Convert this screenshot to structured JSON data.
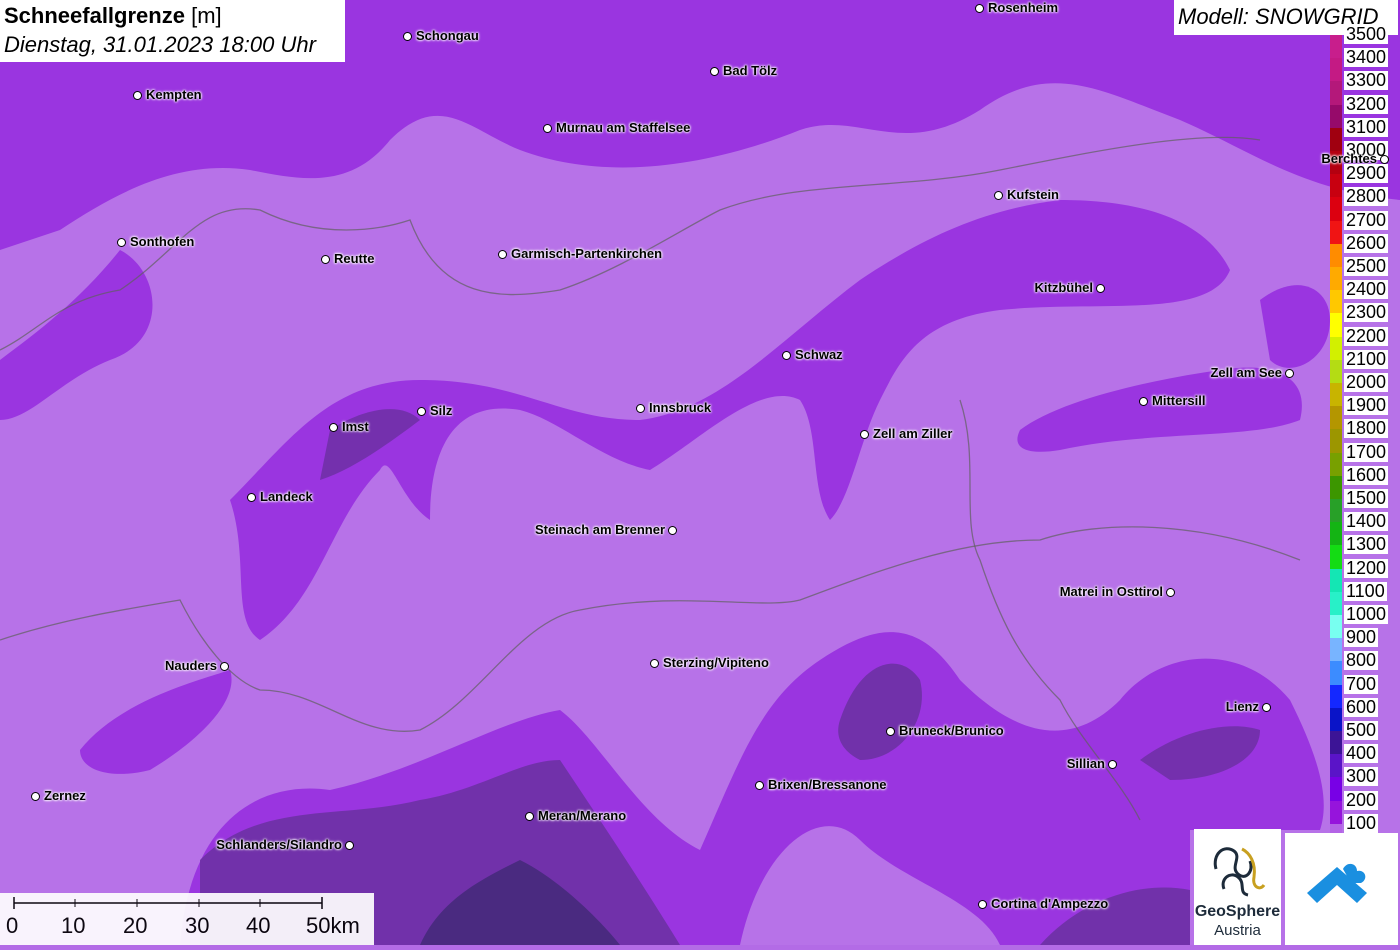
{
  "title": {
    "main_bold": "Schneefallgrenze",
    "unit": "[m]",
    "datetime": "Dienstag, 31.01.2023 18:00 Uhr"
  },
  "model": "Modell: SNOWGRID",
  "legend": {
    "values": [
      "3500",
      "3400",
      "3300",
      "3200",
      "3100",
      "3000",
      "2900",
      "2800",
      "2700",
      "2600",
      "2500",
      "2400",
      "2300",
      "2200",
      "2100",
      "2000",
      "1900",
      "1800",
      "1700",
      "1600",
      "1500",
      "1400",
      "1300",
      "1200",
      "1100",
      "1000",
      "900",
      "800",
      "700",
      "600",
      "500",
      "400",
      "300",
      "200",
      "100"
    ],
    "colors": [
      "#c81e8c",
      "#c41a84",
      "#b4187a",
      "#960a6a",
      "#a00010",
      "#b40010",
      "#c80010",
      "#dc0010",
      "#f01414",
      "#ff8c00",
      "#ffaa00",
      "#ffc800",
      "#ffff00",
      "#d2f000",
      "#b4dc14",
      "#c8b400",
      "#b49600",
      "#9c9600",
      "#78a000",
      "#3c9600",
      "#28a028",
      "#14b414",
      "#14dc14",
      "#14e6b4",
      "#28f0c8",
      "#78fff0",
      "#78b4ff",
      "#3c8cff",
      "#1428ff",
      "#0a14c8",
      "#3c1496",
      "#5a14c8",
      "#7800e6",
      "#9614dc",
      "#b464e6"
    ]
  },
  "cities": [
    {
      "name": "Rosenheim"
    },
    {
      "name": "Schongau"
    },
    {
      "name": "Kempten"
    },
    {
      "name": "Bad Tölz"
    },
    {
      "name": "Murnau am Staffelsee"
    },
    {
      "name": "Berchtes"
    },
    {
      "name": "Kufstein"
    },
    {
      "name": "Sonthofen"
    },
    {
      "name": "Reutte"
    },
    {
      "name": "Garmisch-Partenkirchen"
    },
    {
      "name": "Kitzbühel"
    },
    {
      "name": "Schwaz"
    },
    {
      "name": "Zell am See"
    },
    {
      "name": "Mittersill"
    },
    {
      "name": "Imst"
    },
    {
      "name": "Silz"
    },
    {
      "name": "Innsbruck"
    },
    {
      "name": "Zell am Ziller"
    },
    {
      "name": "Landeck"
    },
    {
      "name": "Steinach am Brenner"
    },
    {
      "name": "Matrei in Osttirol"
    },
    {
      "name": "Nauders"
    },
    {
      "name": "Sterzing/Vipiteno"
    },
    {
      "name": "Lienz"
    },
    {
      "name": "Bruneck/Brunico"
    },
    {
      "name": "Sillian"
    },
    {
      "name": "Brixen/Bressanone"
    },
    {
      "name": "Zernez"
    },
    {
      "name": "Meran/Merano"
    },
    {
      "name": "Schlanders/Silandro"
    },
    {
      "name": "Cortina d'Ampezzo"
    }
  ],
  "scale": {
    "labels": [
      "0",
      "10",
      "20",
      "30",
      "40",
      "50km"
    ]
  },
  "logos": {
    "geosphere_name": "GeoSphere",
    "geosphere_sub": "Austria"
  }
}
